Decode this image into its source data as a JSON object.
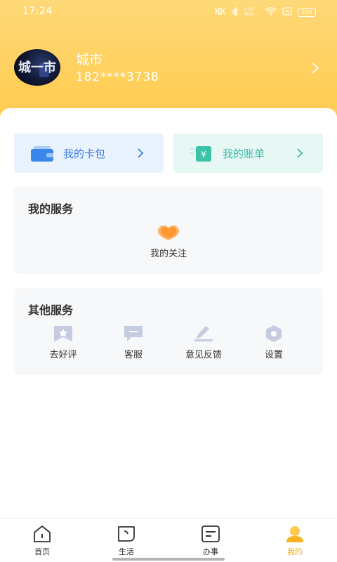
{
  "status_bar": {
    "time": "17:24",
    "signal_text": "0.00\nKB/S",
    "battery": "100"
  },
  "profile": {
    "avatar_text": "城一市",
    "name": "城市",
    "phone": "182****3738"
  },
  "cards": {
    "wallet_label": "我的卡包",
    "bill_label": "我的账单",
    "bill_icon_symbol": "¥"
  },
  "my_services": {
    "title": "我的服务",
    "items": [
      {
        "label": "我的关注",
        "icon": "heart-icon"
      }
    ]
  },
  "other_services": {
    "title": "其他服务",
    "items": [
      {
        "label": "去好评",
        "icon": "star-bookmark-icon"
      },
      {
        "label": "客服",
        "icon": "chat-icon"
      },
      {
        "label": "意见反馈",
        "icon": "pen-icon"
      },
      {
        "label": "设置",
        "icon": "gear-icon"
      }
    ]
  },
  "tabbar": {
    "tabs": [
      {
        "label": "首页",
        "icon": "home-icon",
        "active": false
      },
      {
        "label": "生活",
        "icon": "life-icon",
        "active": false
      },
      {
        "label": "办事",
        "icon": "tasks-icon",
        "active": false
      },
      {
        "label": "我的",
        "icon": "user-icon",
        "active": true
      }
    ]
  },
  "colors": {
    "header": "#ffcf5a",
    "accent_active": "#f5b31f",
    "wallet_text": "#3a7be0",
    "bill_text": "#3cbba3"
  }
}
